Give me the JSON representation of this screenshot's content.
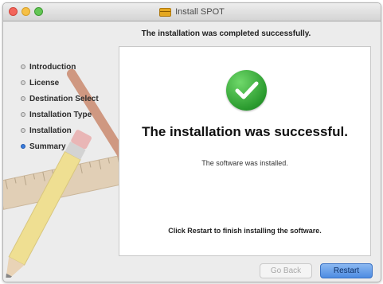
{
  "window": {
    "title": "Install SPOT",
    "heading": "The installation was completed successfully."
  },
  "sidebar": {
    "steps": [
      {
        "label": "Introduction",
        "active": false
      },
      {
        "label": "License",
        "active": false
      },
      {
        "label": "Destination Select",
        "active": false
      },
      {
        "label": "Installation Type",
        "active": false
      },
      {
        "label": "Installation",
        "active": false
      },
      {
        "label": "Summary",
        "active": true
      }
    ]
  },
  "main": {
    "success_title": "The installation was successful.",
    "installed_text": "The software was installed.",
    "restart_message": "Click Restart to finish installing the software."
  },
  "buttons": {
    "go_back": "Go Back",
    "restart": "Restart"
  },
  "icons": {
    "window_icon": "package-icon",
    "status_icon": "checkmark-icon"
  },
  "colors": {
    "accent": "#4d8ce2",
    "success": "#2a9a2e"
  }
}
